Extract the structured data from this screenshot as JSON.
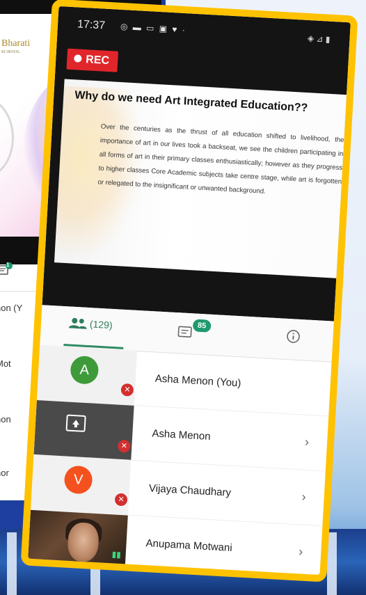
{
  "left_phone": {
    "logo_text": "Bharati",
    "logo_sub": "SCHOOL",
    "chat_badge": "1",
    "names": [
      "non (Y",
      "Mot",
      "non",
      "nor"
    ]
  },
  "status_bar": {
    "time": "17:37",
    "left_icons": "◎ ▬ ▭ ▣ ♥ ·",
    "right_icons": "◈ ⊿ ▮"
  },
  "recording": {
    "label": "REC"
  },
  "slide": {
    "title": "Why do we need Art Integrated Education??",
    "body": "Over the centuries as the thrust of all education shifted to livelihood, the importance of art in our lives took a backseat, we see the children participating in all forms of art in their primary classes enthusiastically; however as they progress to higher classes Core Academic subjects take centre stage, while art is forgotten or relegated to the insignificant or unwanted background."
  },
  "tabs": {
    "people_count": "(129)",
    "chat_badge": "85"
  },
  "participants": [
    {
      "name": "Asha Menon (You)",
      "tile": "avatar",
      "initial": "A",
      "avatar_color": "#3f9a3a",
      "mic": "muted"
    },
    {
      "name": "Asha Menon",
      "tile": "screen-share",
      "mic": "muted",
      "chevron": "›"
    },
    {
      "name": "Vijaya Chaudhary",
      "tile": "avatar",
      "initial": "V",
      "avatar_color": "#f4511e",
      "mic": "muted",
      "chevron": "›"
    },
    {
      "name": "Anupama Motwani",
      "tile": "video",
      "mic": "speaking",
      "chevron": "›"
    }
  ],
  "colors": {
    "frame": "#ffc200",
    "accent": "#2e8b64",
    "rec": "#e0262b"
  }
}
